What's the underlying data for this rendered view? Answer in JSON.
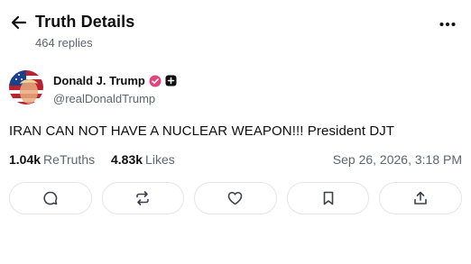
{
  "header": {
    "title": "Truth Details",
    "replies": "464 replies"
  },
  "author": {
    "display_name": "Donald J. Trump",
    "handle": "@realDonaldTrump"
  },
  "post": {
    "text": "IRAN CAN NOT HAVE A NUCLEAR WEAPON!!! President DJT",
    "retruths_count": "1.04k",
    "retruths_label": "ReTruths",
    "likes_count": "4.83k",
    "likes_label": "Likes",
    "timestamp": "Sep 26, 2026, 3:18 PM"
  },
  "icons": {
    "back": "arrow-left-icon",
    "more": "more-horizontal-icon",
    "verified": "verified-badge-icon",
    "plus": "plus-badge-icon",
    "reply": "comment-icon",
    "retruth": "repost-icon",
    "like": "heart-icon",
    "bookmark": "bookmark-icon",
    "share": "share-icon"
  },
  "colors": {
    "text": "#0f0f10",
    "muted": "#5f6470",
    "verified": "#e0457b",
    "border": "#e3e5ea"
  }
}
